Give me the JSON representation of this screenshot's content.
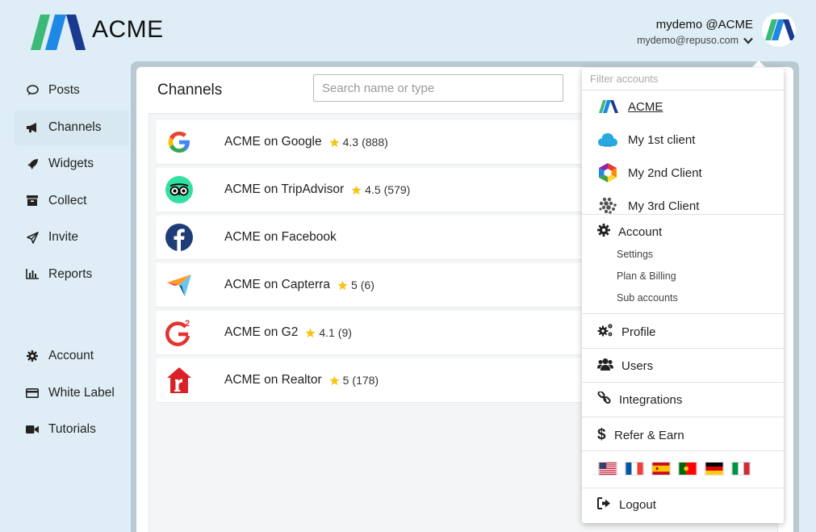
{
  "header": {
    "brand": "ACME",
    "user_name": "mydemo @ACME",
    "user_email": "mydemo@repuso.com"
  },
  "sidebar": {
    "items": [
      {
        "label": "Posts",
        "icon": "comment-icon"
      },
      {
        "label": "Channels",
        "icon": "megaphone-icon",
        "active": true
      },
      {
        "label": "Widgets",
        "icon": "rocket-icon"
      },
      {
        "label": "Collect",
        "icon": "archive-box-icon"
      },
      {
        "label": "Invite",
        "icon": "paper-plane-icon"
      },
      {
        "label": "Reports",
        "icon": "bar-chart-icon"
      }
    ],
    "items2": [
      {
        "label": "Account",
        "icon": "gear-icon"
      },
      {
        "label": "White Label",
        "icon": "credit-card-icon"
      },
      {
        "label": "Tutorials",
        "icon": "video-camera-icon"
      }
    ]
  },
  "main": {
    "title": "Channels",
    "search_placeholder": "Search name or type",
    "channels": [
      {
        "name": "ACME on Google",
        "rating": "4.3",
        "count": "(888)",
        "icon": "google-icon"
      },
      {
        "name": "ACME on TripAdvisor",
        "rating": "4.5",
        "count": "(579)",
        "icon": "tripadvisor-icon"
      },
      {
        "name": "ACME on Facebook",
        "rating": "",
        "count": "",
        "icon": "facebook-icon"
      },
      {
        "name": "ACME on Capterra",
        "rating": "5",
        "count": "(6)",
        "icon": "capterra-icon"
      },
      {
        "name": "ACME on G2",
        "rating": "4.1",
        "count": "(9)",
        "icon": "g2-icon"
      },
      {
        "name": "ACME on Realtor",
        "rating": "5",
        "count": "(178)",
        "icon": "realtor-icon"
      }
    ]
  },
  "dropdown": {
    "filter_placeholder": "Filter accounts",
    "accounts": [
      {
        "label": "ACME",
        "icon": "acme-logo-icon"
      },
      {
        "label": "My 1st client",
        "icon": "cloud-icon"
      },
      {
        "label": "My 2nd Client",
        "icon": "hexagon-logo-icon"
      },
      {
        "label": "My 3rd Client",
        "icon": "dots-cluster-icon"
      }
    ],
    "account_label": "Account",
    "account_sub": [
      "Settings",
      "Plan & Billing",
      "Sub accounts"
    ],
    "profile": "Profile",
    "users": "Users",
    "integrations": "Integrations",
    "refer": "Refer & Earn",
    "logout": "Logout",
    "flags": [
      "us-flag-icon",
      "france-flag-icon",
      "spain-flag-icon",
      "portugal-flag-icon",
      "germany-flag-icon",
      "italy-flag-icon"
    ]
  },
  "colors": {
    "background": "#dfeef6",
    "active_nav": "#d7e8f0",
    "star": "#f5c518",
    "logo_green": "#3cb878",
    "logo_blue": "#1e88e5",
    "logo_navy": "#1a3a8f"
  }
}
